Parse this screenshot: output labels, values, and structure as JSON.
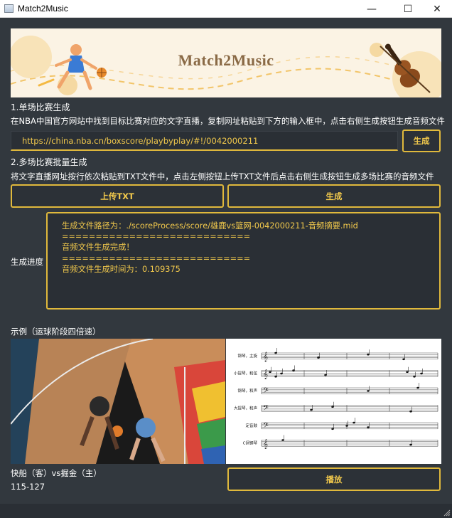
{
  "window": {
    "title": "Match2Music",
    "minimize_glyph": "—",
    "maximize_glyph": "☐",
    "close_glyph": "✕"
  },
  "banner": {
    "title": "Match2Music"
  },
  "single": {
    "section_title": "1.单场比赛生成",
    "description": "在NBA中国官方网站中找到目标比赛对应的文字直播，复制网址粘贴到下方的输入框中，点击右侧生成按钮生成音频文件",
    "url_value": "https://china.nba.cn/boxscore/playbyplay/#!/0042000211",
    "generate_label": "生成"
  },
  "batch": {
    "section_title": "2.多场比赛批量生成",
    "description": "将文字直播网址按行依次粘贴到TXT文件中，点击左侧按钮上传TXT文件后点击右侧生成按钮生成多场比赛的音频文件",
    "upload_label": "上传TXT",
    "generate_label": "生成"
  },
  "progress": {
    "label": "生成进度",
    "log": [
      "生成文件路径为：./scoreProcess/score/雄鹿vs篮网-0042000211-音频摘要.mid",
      "============================",
      "音频文件生成完成！",
      "============================",
      "音频文件生成时间为：0.109375"
    ]
  },
  "example": {
    "label": "示例（运球阶段四倍速）",
    "staff_labels": [
      "钢琴，主旋",
      "小提琴，和弦",
      "钢琴，和声",
      "大提琴，和声",
      "定音鼓",
      "C调钢琴"
    ],
    "match_teams": "快船（客）vs掘金（主）",
    "match_score": "115-127",
    "play_label": "播放"
  },
  "colors": {
    "accent": "#e0b93c",
    "accent_text": "#f2c94c",
    "background": "#32383e",
    "input_background": "#2a2f35"
  }
}
